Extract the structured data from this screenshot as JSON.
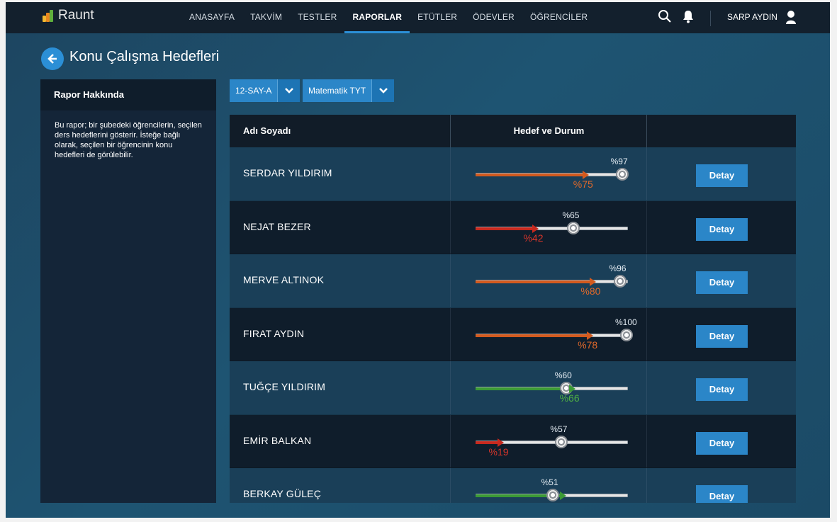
{
  "app": {
    "name": "Raunt"
  },
  "nav": {
    "items": [
      {
        "label": "ANASAYFA",
        "active": false
      },
      {
        "label": "TAKVİM",
        "active": false
      },
      {
        "label": "TESTLER",
        "active": false
      },
      {
        "label": "RAPORLAR",
        "active": true
      },
      {
        "label": "ETÜTLER",
        "active": false
      },
      {
        "label": "ÖDEVLER",
        "active": false
      },
      {
        "label": "ÖĞRENCİLER",
        "active": false
      }
    ],
    "user_name": "SARP AYDIN"
  },
  "page": {
    "title": "Konu Çalışma Hedefleri"
  },
  "about": {
    "heading": "Rapor Hakkında",
    "text": "Bu rapor; bir şubedeki öğrencilerin, seçilen ders hedeflerini gösterir. İsteğe bağlı olarak, seçilen bir öğrencinin konu hedefleri de görülebilir."
  },
  "filters": {
    "class_value": "12-SAY-A",
    "course_value": "Matematik TYT"
  },
  "table": {
    "col_name": "Adı Soyadı",
    "col_goal": "Hedef ve Durum",
    "detail_label": "Detay",
    "rows": [
      {
        "name": "SERDAR YILDIRIM",
        "goal": 97,
        "value": 75,
        "goal_label": "%97",
        "value_label": "%75",
        "status_color": "#d35a1e"
      },
      {
        "name": "NEJAT BEZER",
        "goal": 65,
        "value": 42,
        "goal_label": "%65",
        "value_label": "%42",
        "status_color": "#c8291e"
      },
      {
        "name": "MERVE ALTINOK",
        "goal": 96,
        "value": 80,
        "goal_label": "%96",
        "value_label": "%80",
        "status_color": "#d35a1e"
      },
      {
        "name": "FIRAT AYDIN",
        "goal": 100,
        "value": 78,
        "goal_label": "%100",
        "value_label": "%78",
        "status_color": "#d35a1e"
      },
      {
        "name": "TUĞÇE YILDIRIM",
        "goal": 60,
        "value": 66,
        "goal_label": "%60",
        "value_label": "%66",
        "status_color": "#3b9a35"
      },
      {
        "name": "EMİR BALKAN",
        "goal": 57,
        "value": 19,
        "goal_label": "%57",
        "value_label": "%19",
        "status_color": "#c8291e"
      },
      {
        "name": "BERKAY GÜLEÇ",
        "goal": 51,
        "value": 60,
        "goal_label": "%51",
        "value_label": "",
        "status_color": "#3b9a35"
      }
    ]
  }
}
